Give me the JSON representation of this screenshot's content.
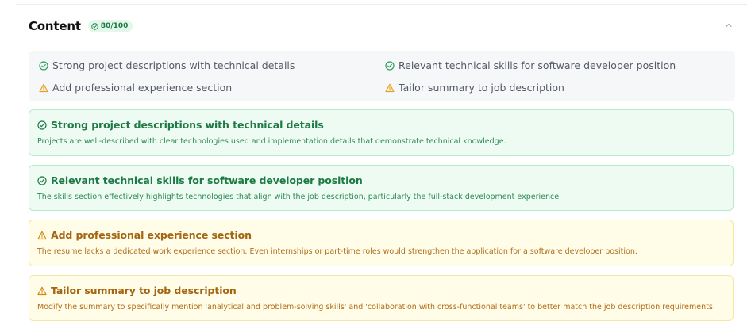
{
  "section": {
    "title": "Content",
    "score": "80/100"
  },
  "icons": {
    "success": "check-circle-icon",
    "warning": "warning-triangle-icon",
    "collapse": "chevron-up-icon"
  },
  "colors": {
    "success": "#1e7a45",
    "warning": "#e8a020",
    "success_bg": "#edfbf2",
    "warning_bg": "#fffce8"
  },
  "summary": [
    {
      "type": "success",
      "text": "Strong project descriptions with technical details"
    },
    {
      "type": "success",
      "text": "Relevant technical skills for software developer position"
    },
    {
      "type": "warning",
      "text": "Add professional experience section"
    },
    {
      "type": "warning",
      "text": "Tailor summary to job description"
    }
  ],
  "cards": [
    {
      "type": "success",
      "title": "Strong project descriptions with technical details",
      "description": "Projects are well-described with clear technologies used and implementation details that demonstrate technical knowledge."
    },
    {
      "type": "success",
      "title": "Relevant technical skills for software developer position",
      "description": "The skills section effectively highlights technologies that align with the job description, particularly the full-stack development experience."
    },
    {
      "type": "warning",
      "title": "Add professional experience section",
      "description": "The resume lacks a dedicated work experience section. Even internships or part-time roles would strengthen the application for a software developer position."
    },
    {
      "type": "warning",
      "title": "Tailor summary to job description",
      "description": "Modify the summary to specifically mention 'analytical and problem-solving skills' and 'collaboration with cross-functional teams' to better match the job description requirements."
    }
  ]
}
